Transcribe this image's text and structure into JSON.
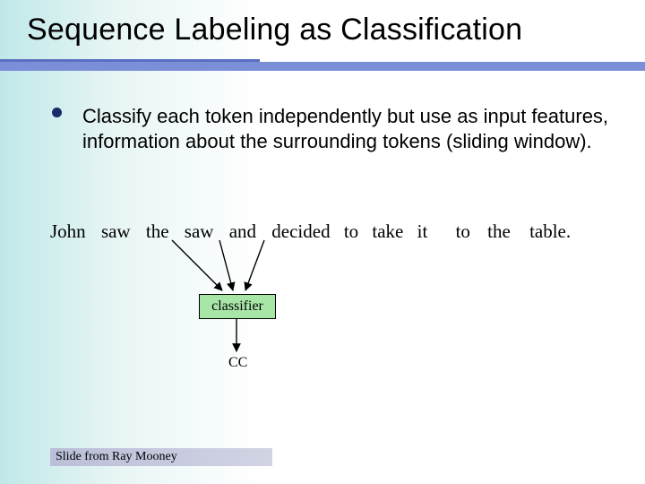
{
  "title": "Sequence Labeling as Classification",
  "bullet": "Classify each token independently but use as input features, information about the surrounding tokens (sliding window).",
  "sentence": {
    "john": "John",
    "saw1": "saw",
    "the1": "the",
    "saw2": "saw",
    "and": "and",
    "decided": "decided",
    "to1": "to",
    "take": "take",
    "it": "it",
    "to2": "to",
    "the2": "the",
    "table": "table."
  },
  "classifier_label": "classifier",
  "output_tag": "CC",
  "attribution": "Slide from Ray Mooney"
}
